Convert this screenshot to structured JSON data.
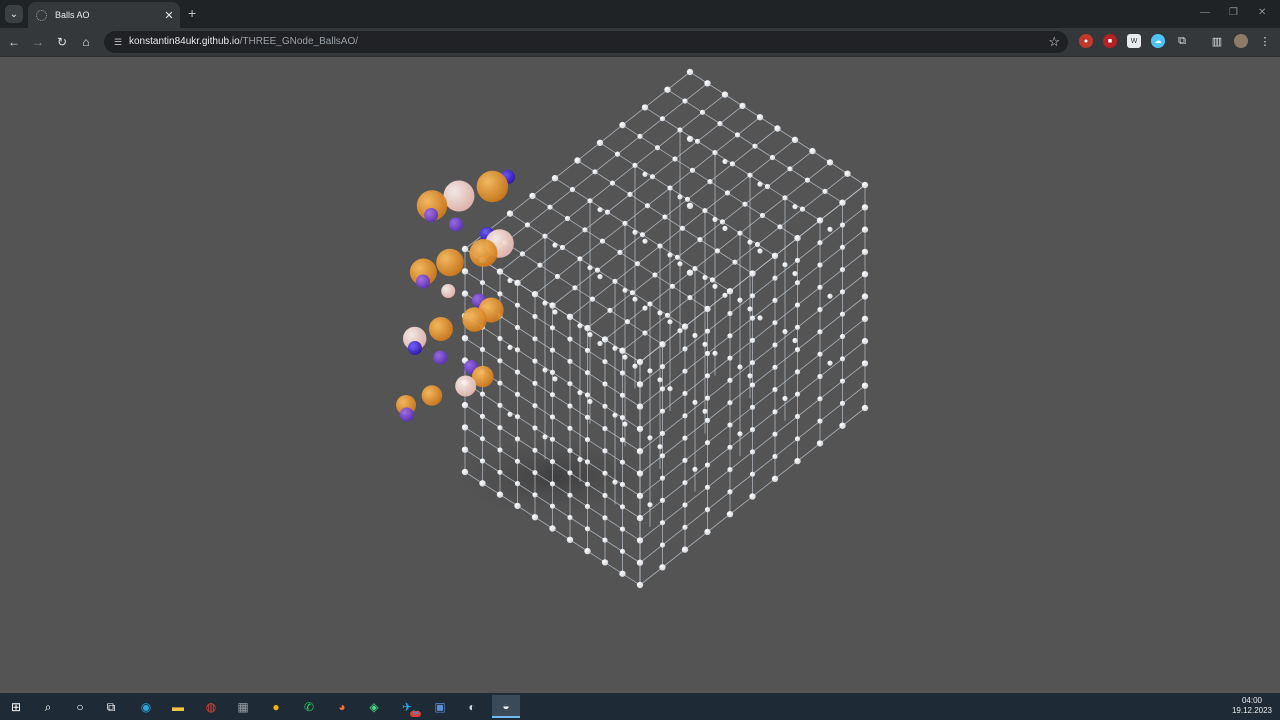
{
  "browser": {
    "tab": {
      "title": "Balls AO"
    },
    "address": {
      "host": "konstantin84ukr.github.io",
      "path": "/THREE_GNode_BallsAO/"
    }
  },
  "taskbar": {
    "clock_time": "04:00",
    "clock_date": "19.12.2023",
    "telegram_badge": "54"
  },
  "scene": {
    "background": "#545454",
    "grid_size": 10,
    "node_color": "#ffffff",
    "edge_color": "#c8d2dc",
    "ball_colors": [
      "#f0a030",
      "#e08a26",
      "#8a4fd0",
      "#4a2bd8",
      "#f2d8d4"
    ]
  },
  "icons": {
    "back": "back-arrow-icon",
    "forward": "forward-arrow-icon",
    "reload": "reload-icon",
    "home": "home-icon",
    "star": "star-icon"
  }
}
